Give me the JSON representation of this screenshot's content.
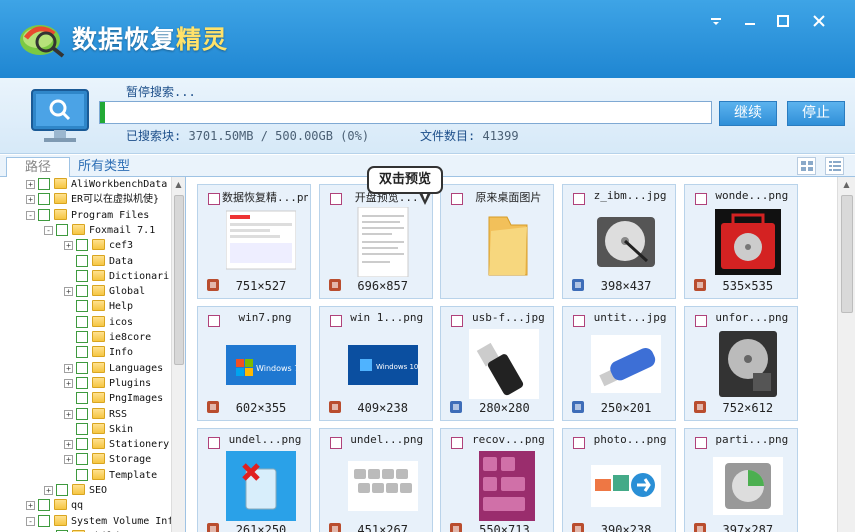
{
  "app": {
    "title_main": "数据恢复",
    "title_accent": "精灵",
    "window_controls": [
      "minimize",
      "maximize",
      "close"
    ]
  },
  "search": {
    "status": "暂停搜索...",
    "progress_fraction": 0.0074,
    "continue_label": "继续",
    "stop_label": "停止",
    "searched_label": "已搜索块:",
    "searched_value": "3701.50MB / 500.00GB (0%)",
    "filecount_label": "文件数目:",
    "filecount_value": "41399"
  },
  "tabs": {
    "path": "路径",
    "all_types": "所有类型"
  },
  "tree": [
    {
      "label": "AliWorkbenchData",
      "depth": 0,
      "toggle": "+"
    },
    {
      "label": "ER可以在虚拟机使}",
      "depth": 0,
      "toggle": "+"
    },
    {
      "label": "Program Files",
      "depth": 0,
      "toggle": "-"
    },
    {
      "label": "Foxmail 7.1",
      "depth": 1,
      "toggle": "-"
    },
    {
      "label": "cef3",
      "depth": 2,
      "toggle": "+"
    },
    {
      "label": "Data",
      "depth": 2,
      "toggle": ""
    },
    {
      "label": "Dictionari",
      "depth": 2,
      "toggle": ""
    },
    {
      "label": "Global",
      "depth": 2,
      "toggle": "+"
    },
    {
      "label": "Help",
      "depth": 2,
      "toggle": ""
    },
    {
      "label": "icos",
      "depth": 2,
      "toggle": ""
    },
    {
      "label": "ie8core",
      "depth": 2,
      "toggle": ""
    },
    {
      "label": "Info",
      "depth": 2,
      "toggle": ""
    },
    {
      "label": "Languages",
      "depth": 2,
      "toggle": "+"
    },
    {
      "label": "Plugins",
      "depth": 2,
      "toggle": "+"
    },
    {
      "label": "PngImages",
      "depth": 2,
      "toggle": ""
    },
    {
      "label": "RSS",
      "depth": 2,
      "toggle": "+"
    },
    {
      "label": "Skin",
      "depth": 2,
      "toggle": ""
    },
    {
      "label": "Stationery",
      "depth": 2,
      "toggle": "+"
    },
    {
      "label": "Storage",
      "depth": 2,
      "toggle": "+"
    },
    {
      "label": "Template",
      "depth": 2,
      "toggle": ""
    },
    {
      "label": "SEO",
      "depth": 1,
      "toggle": "+"
    },
    {
      "label": "qq",
      "depth": 0,
      "toggle": "+"
    },
    {
      "label": "System Volume Inf",
      "depth": 0,
      "toggle": "-"
    },
    {
      "label": "Child",
      "depth": 1,
      "toggle": ""
    }
  ],
  "files": [
    {
      "name": "数据恢复精...png",
      "dims": "751×527",
      "ftype": "png",
      "thumb": "screenshot-thumb"
    },
    {
      "name": "开盘预览...",
      "dims": "696×857",
      "ftype": "png",
      "thumb": "document-thumb"
    },
    {
      "name": "原来桌面图片",
      "dims": "",
      "ftype": "folder",
      "thumb": "folder-thumb"
    },
    {
      "name": "z_ibm...jpg",
      "dims": "398×437",
      "ftype": "jpg",
      "thumb": "harddisk-thumb"
    },
    {
      "name": "wonde...png",
      "dims": "535×535",
      "ftype": "png",
      "thumb": "red-drive-thumb"
    },
    {
      "name": "win7.png",
      "dims": "602×355",
      "ftype": "png",
      "thumb": "windows7-thumb"
    },
    {
      "name": "win 1...png",
      "dims": "409×238",
      "ftype": "png",
      "thumb": "windows10-thumb"
    },
    {
      "name": "usb-f...jpg",
      "dims": "280×280",
      "ftype": "jpg",
      "thumb": "usb-thumb"
    },
    {
      "name": "untit...jpg",
      "dims": "250×201",
      "ftype": "jpg",
      "thumb": "usb-blue-thumb"
    },
    {
      "name": "unfor...png",
      "dims": "752×612",
      "ftype": "png",
      "thumb": "harddisk2-thumb"
    },
    {
      "name": "undel...png",
      "dims": "261×250",
      "ftype": "png",
      "thumb": "recycle-thumb"
    },
    {
      "name": "undel...png",
      "dims": "451×267",
      "ftype": "png",
      "thumb": "keyboard-thumb"
    },
    {
      "name": "recov...png",
      "dims": "550×713",
      "ftype": "png",
      "thumb": "recover-keys-thumb"
    },
    {
      "name": "photo...png",
      "dims": "390×238",
      "ftype": "png",
      "thumb": "photo-thumb"
    },
    {
      "name": "parti...png",
      "dims": "397×287",
      "ftype": "png",
      "thumb": "partition-thumb"
    }
  ],
  "tooltip": "双击预览",
  "colors": {
    "accent": "#2f8fd8",
    "progress": "#22a935",
    "title_bg": "#1f86d2"
  }
}
